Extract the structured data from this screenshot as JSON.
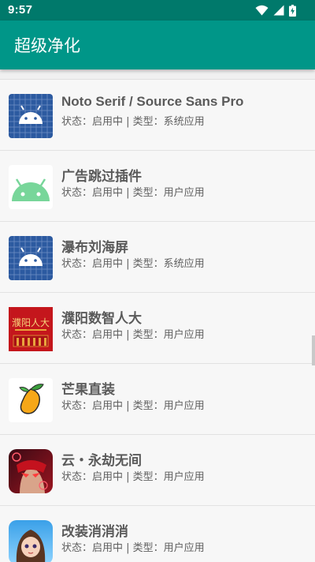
{
  "status_bar": {
    "time": "9:57",
    "icons": [
      "wifi-icon",
      "signal-icon",
      "battery-charging-icon"
    ]
  },
  "app_bar": {
    "title": "超级净化"
  },
  "colors": {
    "status_bar": "#00796b",
    "app_bar": "#009688",
    "android_default_bg": "#2c5aa0",
    "android_green": "#78d69a"
  },
  "apps": [
    {
      "name": "Noto Serif / Source Sans Pro",
      "info": "状态：启用中 | 类型：系统应用",
      "icon": "android-system-icon"
    },
    {
      "name": "广告跳过插件",
      "info": "状态：启用中 | 类型：用户应用",
      "icon": "android-green-icon"
    },
    {
      "name": "瀑布刘海屏",
      "info": "状态：启用中 | 类型：系统应用",
      "icon": "android-system-icon"
    },
    {
      "name": "濮阳数智人大",
      "info": "状态：启用中 | 类型：用户应用",
      "icon": "puyang-renda-icon",
      "icon_text": "濮阳人大"
    },
    {
      "name": "芒果直装",
      "info": "状态：启用中 | 类型：用户应用",
      "icon": "mango-icon"
    },
    {
      "name": "云・永劫无间",
      "info": "状态：启用中 | 类型：用户应用",
      "icon": "game-warrior-icon"
    },
    {
      "name": "改装消消消",
      "info": "状态：启用中 | 类型：用户应用",
      "icon": "game-girl-icon"
    }
  ]
}
